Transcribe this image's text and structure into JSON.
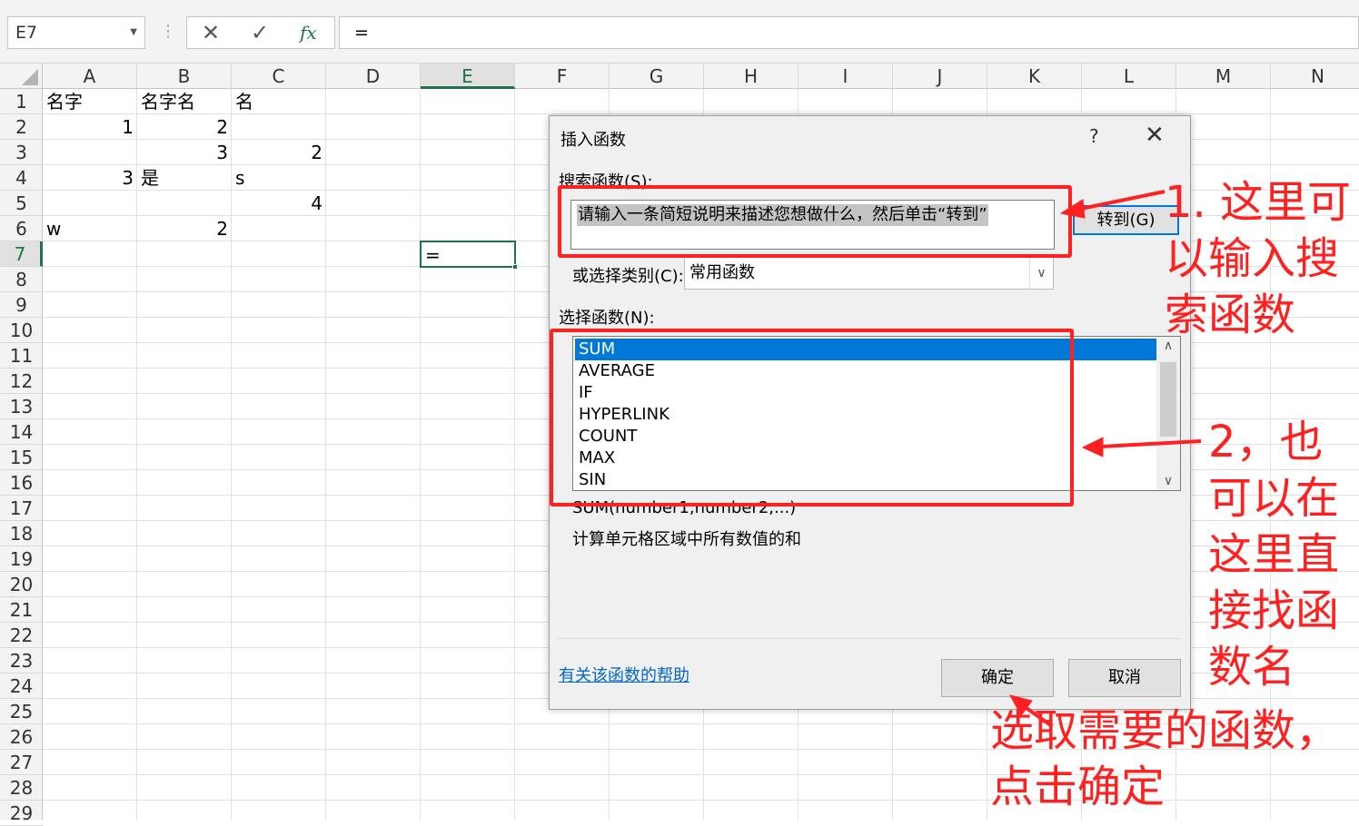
{
  "formula_bar": {
    "name_box": "E7",
    "cancel_icon": "✕",
    "enter_icon": "✓",
    "fx_label": "fx",
    "formula": "="
  },
  "columns": [
    "A",
    "B",
    "C",
    "D",
    "E",
    "F",
    "G",
    "H",
    "I",
    "J",
    "K",
    "L",
    "M",
    "N"
  ],
  "rows": [
    "1",
    "2",
    "3",
    "4",
    "5",
    "6",
    "7",
    "8",
    "9",
    "10",
    "11",
    "12",
    "13",
    "14",
    "15",
    "16",
    "17",
    "18",
    "19",
    "20",
    "21",
    "22",
    "23",
    "24",
    "25",
    "26",
    "27",
    "28",
    "29"
  ],
  "cells": {
    "A1": "名字",
    "B1": "名字名",
    "C1": "名",
    "A2": "1",
    "B2": "2",
    "B3": "3",
    "C3": "2",
    "A4": "3",
    "B4": "是",
    "C4": "s",
    "C5": "4",
    "A6": "w",
    "B6": "2",
    "E7": "="
  },
  "dialog": {
    "title": "插入函数",
    "help_glyph": "?",
    "close_glyph": "✕",
    "search_label": "搜索函数(S):",
    "search_placeholder": "请输入一条简短说明来描述您想做什么，然后单击“转到”",
    "go_button": "转到(G)",
    "category_label": "或选择类别(C):",
    "category_value": "常用函数",
    "function_list_label": "选择函数(N):",
    "functions": [
      "SUM",
      "AVERAGE",
      "IF",
      "HYPERLINK",
      "COUNT",
      "MAX",
      "SIN"
    ],
    "syntax": "SUM(number1,number2,...)",
    "description": "计算单元格区域中所有数值的和",
    "help_link": "有关该函数的帮助",
    "ok_button": "确定",
    "cancel_button": "取消"
  },
  "annotations": {
    "note1": [
      "1. 这里可",
      "以输入搜",
      "索函数"
    ],
    "note2": [
      "2，也",
      "可以在",
      "这里直",
      "接找函",
      "数名"
    ],
    "note3": [
      "选取需要的函数，",
      "点击确定"
    ]
  },
  "colors": {
    "accent": "#217346",
    "selection": "#0078d7",
    "annotation": "#ff2020"
  }
}
